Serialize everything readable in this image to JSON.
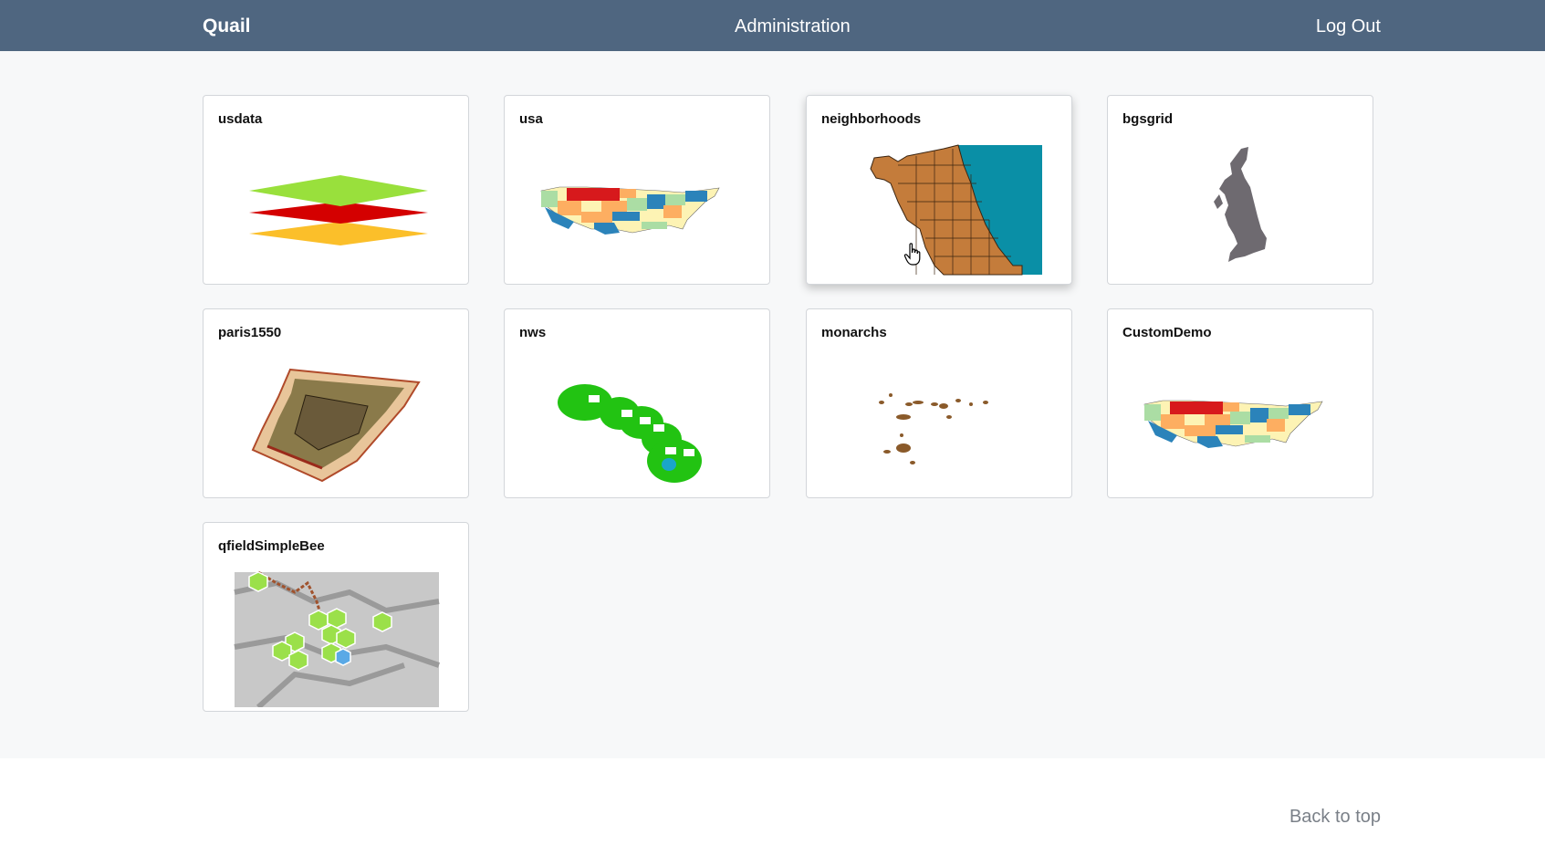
{
  "nav": {
    "brand": "Quail",
    "admin": "Administration",
    "logout": "Log Out"
  },
  "projects": [
    {
      "title": "usdata",
      "thumbnail": "stacked-layers-icon"
    },
    {
      "title": "usa",
      "thumbnail": "usa-map"
    },
    {
      "title": "neighborhoods",
      "thumbnail": "chicago-neighborhoods-map"
    },
    {
      "title": "bgsgrid",
      "thumbnail": "great-britain-map"
    },
    {
      "title": "paris1550",
      "thumbnail": "paris-1550-map"
    },
    {
      "title": "nws",
      "thumbnail": "hawaii-islands-map"
    },
    {
      "title": "monarchs",
      "thumbnail": "scattered-islands-map"
    },
    {
      "title": "CustomDemo",
      "thumbnail": "usa-map"
    },
    {
      "title": "qfieldSimpleBee",
      "thumbnail": "terrain-hexbin-map"
    }
  ],
  "footer": {
    "back_to_top": "Back to top"
  },
  "colors": {
    "navbar": "#4f6680",
    "page_background": "#f7f8f9",
    "layer_green": "#99e03c",
    "layer_red": "#d40000",
    "layer_yellow": "#fbbf2a",
    "chicago_brown": "#c47c3b",
    "lake_teal": "#0a8fa6",
    "britain_grey": "#6e6a70"
  }
}
